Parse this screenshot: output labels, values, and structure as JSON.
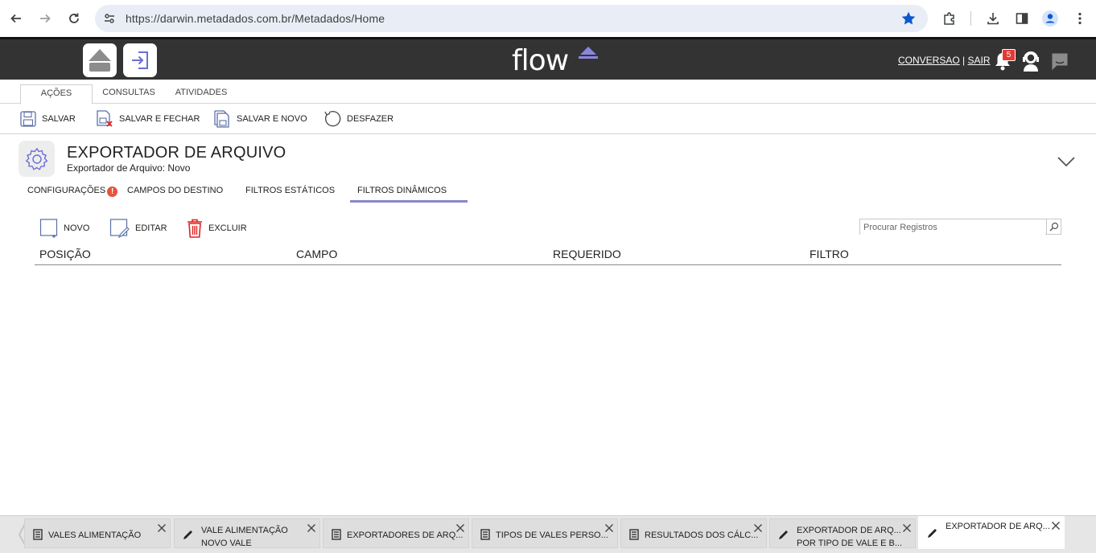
{
  "browser": {
    "url": "https://darwin.metadados.com.br/Metadados/Home"
  },
  "header": {
    "logo_text": "flow",
    "conversa_link": "CONVERSAO",
    "separator": "|",
    "sair_link": "SAIR",
    "notification_count": "5"
  },
  "ribbon": {
    "tabs": [
      "AÇÕES",
      "CONSULTAS",
      "ATIVIDADES"
    ]
  },
  "toolbar": {
    "save": "SALVAR",
    "save_close": "SALVAR E FECHAR",
    "save_new": "SALVAR E NOVO",
    "undo": "DESFAZER"
  },
  "record": {
    "title": "EXPORTADOR DE ARQUIVO",
    "subtitle": "Exportador de Arquivo: Novo"
  },
  "form_tabs": [
    "CONFIGURAÇÕES",
    "CAMPOS DO DESTINO",
    "FILTROS ESTÁTICOS",
    "FILTROS DINÂMICOS"
  ],
  "form_tabs_warning": "!",
  "grid": {
    "new": "NOVO",
    "edit": "EDITAR",
    "delete": "EXCLUIR",
    "search_placeholder": "Procurar Registros",
    "columns": [
      "POSIÇÃO",
      "CAMPO",
      "REQUERIDO",
      "FILTRO"
    ]
  },
  "bottom_tabs": [
    {
      "line1": "VALES ALIMENTAÇÃO",
      "line2": ""
    },
    {
      "line1": "VALE ALIMENTAÇÃO",
      "line2": "NOVO VALE"
    },
    {
      "line1": "EXPORTADORES DE ARQ...",
      "line2": ""
    },
    {
      "line1": "TIPOS DE VALES PERSO...",
      "line2": ""
    },
    {
      "line1": "RESULTADOS DOS CÁLC...",
      "line2": ""
    },
    {
      "line1": "EXPORTADOR DE ARQ...",
      "line2": "POR TIPO DE VALE E B..."
    },
    {
      "line1": "EXPORTADOR DE ARQ...",
      "line2": ""
    }
  ]
}
